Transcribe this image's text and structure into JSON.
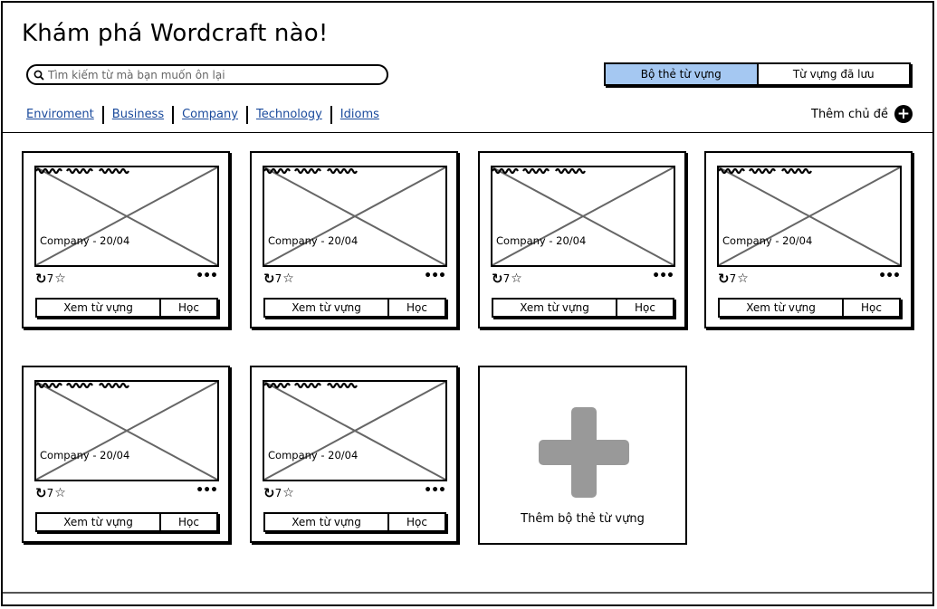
{
  "title": "Khám phá Wordcraft nào!",
  "search": {
    "placeholder": "Tìm kiếm từ mà bạn muốn ôn lại"
  },
  "toggle": {
    "tab1": "Bộ thẻ từ vựng",
    "tab2": "Từ vựng đã lưu",
    "active": "tab1"
  },
  "topics": [
    "Enviroment",
    "Business",
    "Company",
    "Technology",
    "Idioms"
  ],
  "add_topic_label": "Thêm chủ đề",
  "cards": [
    {
      "meta": "Company - 20/04",
      "count": "7",
      "view": "Xem từ vựng",
      "learn": "Học"
    },
    {
      "meta": "Company - 20/04",
      "count": "7",
      "view": "Xem từ vựng",
      "learn": "Học"
    },
    {
      "meta": "Company - 20/04",
      "count": "7",
      "view": "Xem từ vựng",
      "learn": "Học"
    },
    {
      "meta": "Company - 20/04",
      "count": "7",
      "view": "Xem từ vựng",
      "learn": "Học"
    },
    {
      "meta": "Company - 20/04",
      "count": "7",
      "view": "Xem từ vựng",
      "learn": "Học"
    },
    {
      "meta": "Company - 20/04",
      "count": "7",
      "view": "Xem từ vựng",
      "learn": "Học"
    }
  ],
  "add_card_label": "Thêm bộ thẻ từ vựng",
  "colors": {
    "active_tab": "#a5c8f2",
    "link": "#1a4a9c",
    "plus_gray": "#999999"
  }
}
